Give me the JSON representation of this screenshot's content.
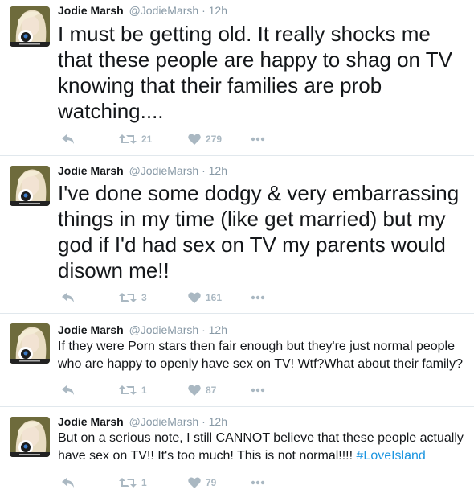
{
  "tweets": [
    {
      "author": "Jodie Marsh",
      "handle": "@JodieMarsh",
      "dot": "·",
      "time": "12h",
      "text": "I must be getting old. It really shocks me that these people are happy to shag on TV knowing that their families are prob watching....",
      "hashtag": "",
      "retweets": "21",
      "likes": "279"
    },
    {
      "author": "Jodie Marsh",
      "handle": "@JodieMarsh",
      "dot": "·",
      "time": "12h",
      "text": "I've done some dodgy & very embarrassing things in my time (like get married) but my god if I'd had sex on TV my parents would disown me!!",
      "hashtag": "",
      "retweets": "3",
      "likes": "161"
    },
    {
      "author": "Jodie Marsh",
      "handle": "@JodieMarsh",
      "dot": "·",
      "time": "12h",
      "text": "If they were Porn stars then fair enough but they're just normal people who are happy to openly have sex on TV! Wtf?What about their family?",
      "hashtag": "",
      "retweets": "1",
      "likes": "87"
    },
    {
      "author": "Jodie Marsh",
      "handle": "@JodieMarsh",
      "dot": "·",
      "time": "12h",
      "text": "But on a serious note, I still CANNOT believe that these people actually have sex on TV!! It's too much! This is not normal!!!! ",
      "hashtag": "#LoveIsland",
      "retweets": "1",
      "likes": "79"
    }
  ],
  "colors": {
    "name": "#14171a",
    "meta": "#8899a6",
    "action": "#aab8c2",
    "hashtag": "#1b95e0",
    "divider": "#e1e8ed"
  },
  "icons": [
    "reply-icon",
    "retweet-icon",
    "like-icon",
    "more-icon"
  ]
}
